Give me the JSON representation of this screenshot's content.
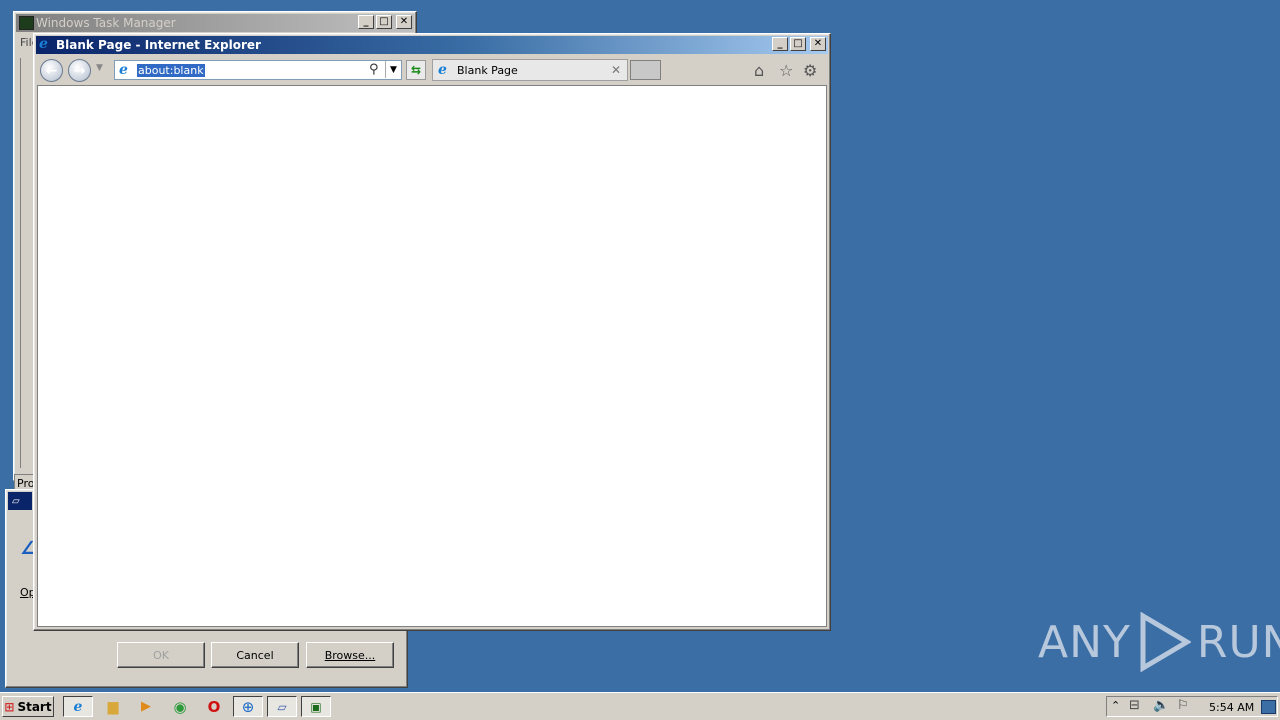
{
  "taskmgr": {
    "title": "Windows Task Manager",
    "menu_fragment": "File",
    "tab_fragment": "Pro"
  },
  "run_dialog": {
    "label_fragment": "Op",
    "buttons": {
      "ok": "OK",
      "cancel": "Cancel",
      "browse": "Browse..."
    }
  },
  "ie": {
    "title": "Blank Page - Internet Explorer",
    "address_value": "about:blank",
    "tab_label": "Blank Page"
  },
  "taskbar": {
    "start_label": "Start",
    "clock": "5:54 AM"
  },
  "watermark": {
    "left": "ANY",
    "right": "RUN"
  },
  "colors": {
    "desktop": "#3a6ea5",
    "active_title_start": "#0a246a",
    "selection": "#316ac5"
  }
}
